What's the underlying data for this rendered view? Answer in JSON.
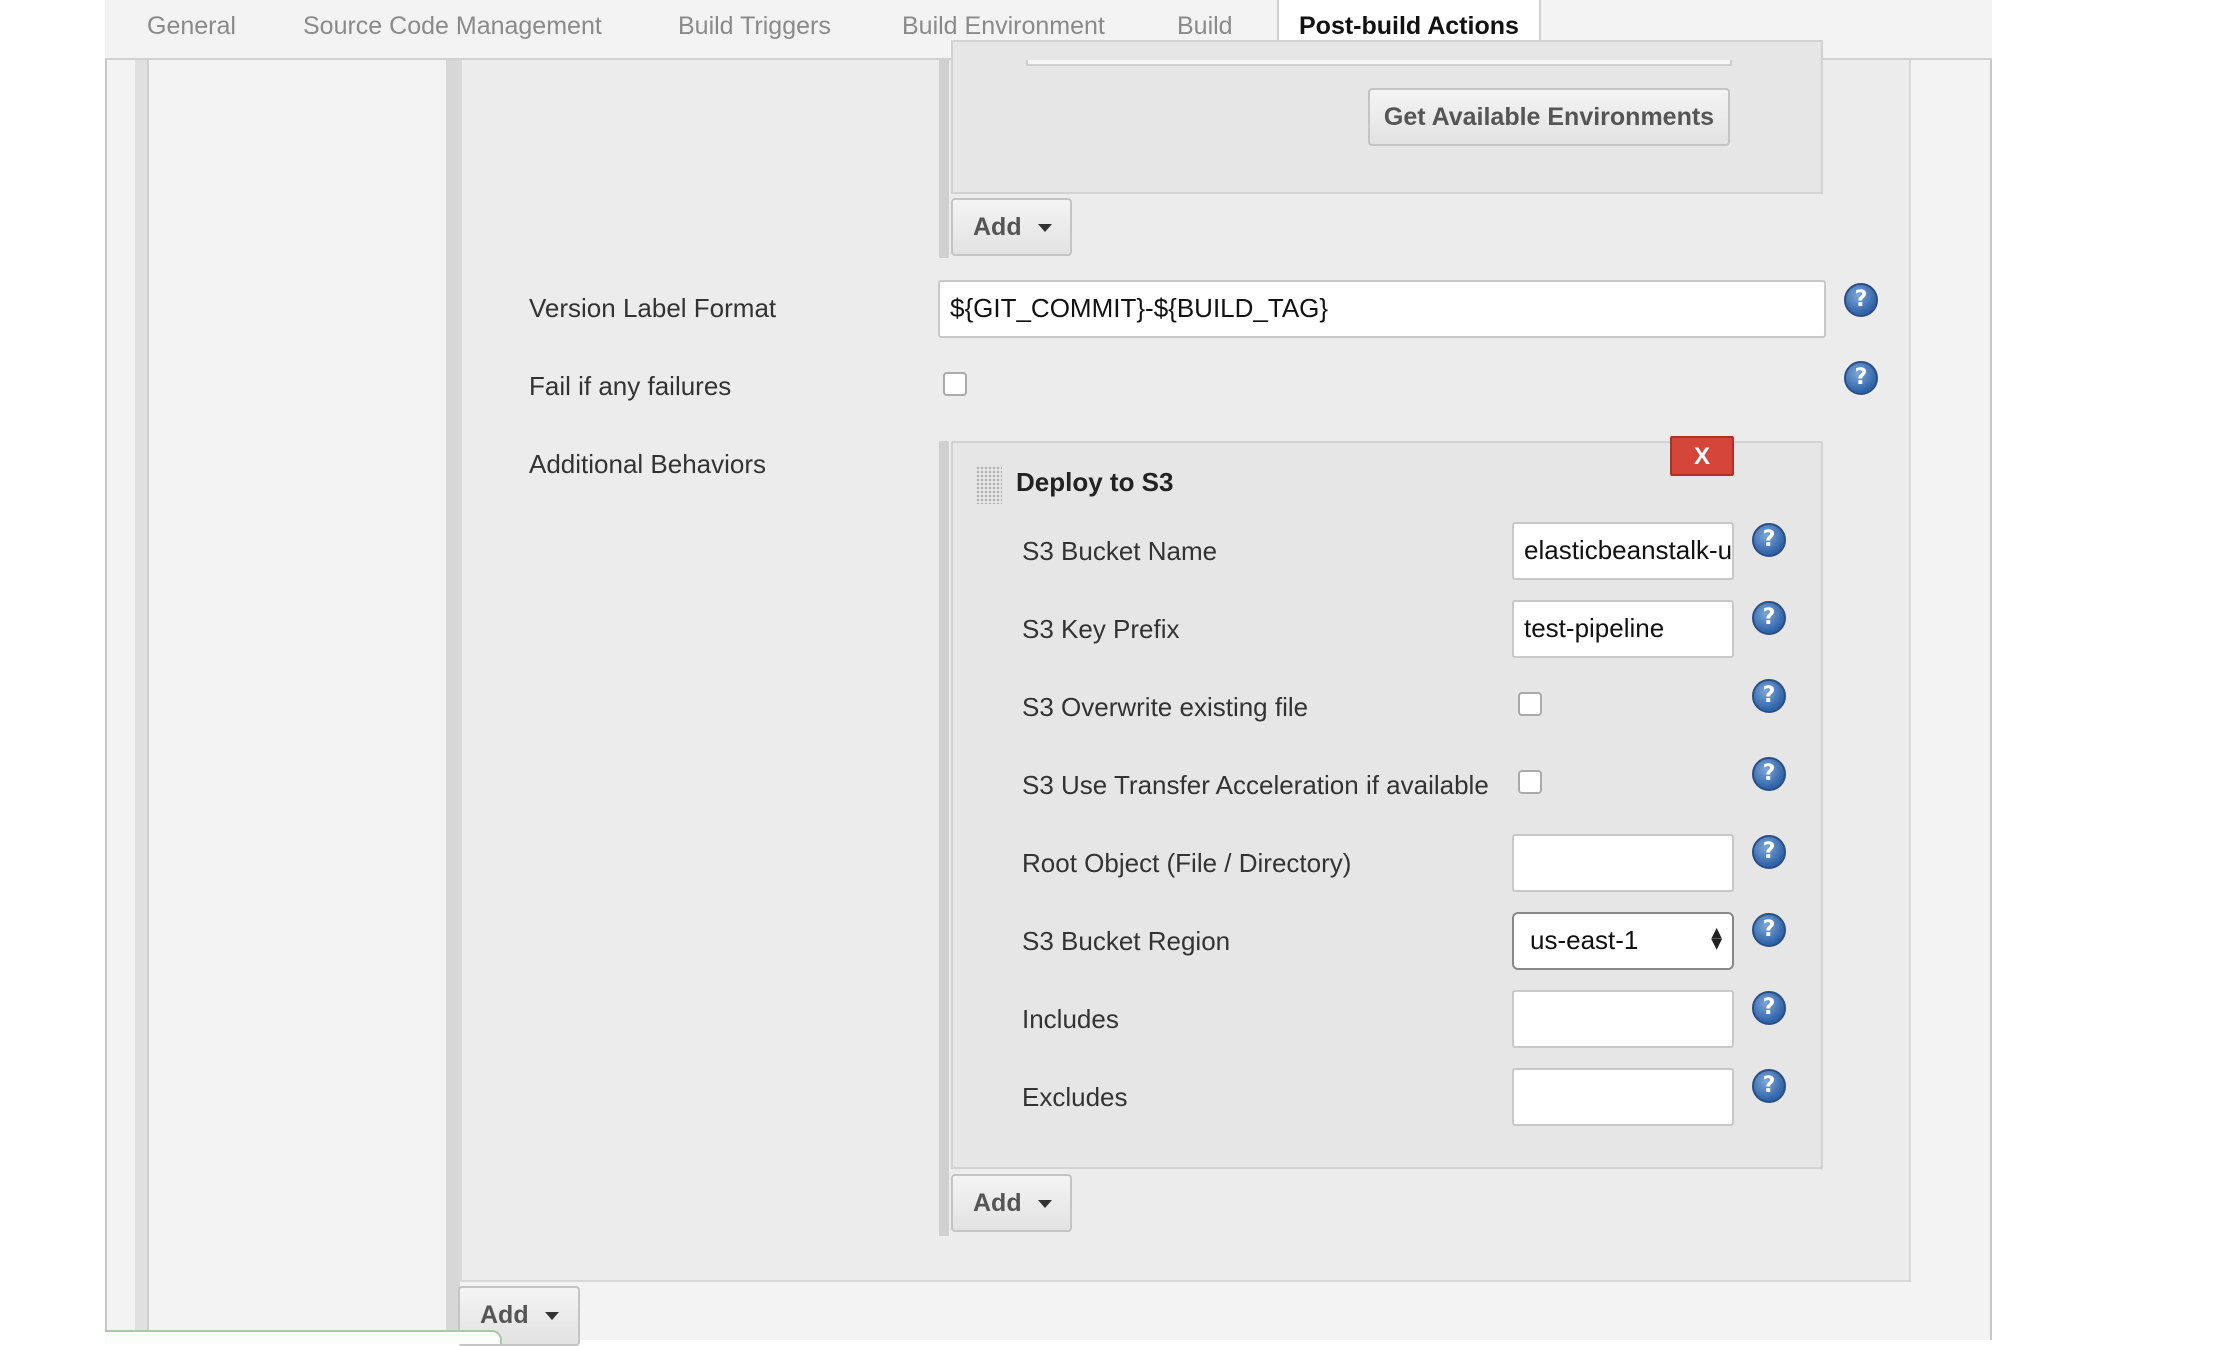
{
  "tabs": [
    {
      "label": "General"
    },
    {
      "label": "Source Code Management"
    },
    {
      "label": "Build Triggers"
    },
    {
      "label": "Build Environment"
    },
    {
      "label": "Build"
    },
    {
      "label": "Post-build Actions",
      "active": true
    }
  ],
  "environments": {
    "get_button_label": "Get Available Environments",
    "add_button_label": "Add"
  },
  "version_label": {
    "label": "Version Label Format",
    "value": "${GIT_COMMIT}-${BUILD_TAG}",
    "help_icon": "?"
  },
  "fail_on_failures": {
    "label": "Fail if any failures",
    "checked": false,
    "help_icon": "?"
  },
  "additional_behaviors": {
    "label": "Additional Behaviors",
    "add_button_label": "Add",
    "deploy_to_s3": {
      "title": "Deploy to S3",
      "delete_label": "X",
      "fields": {
        "bucket_name": {
          "label": "S3 Bucket Name",
          "value": "elasticbeanstalk-u"
        },
        "key_prefix": {
          "label": "S3 Key Prefix",
          "value": "test-pipeline"
        },
        "overwrite": {
          "label": "S3 Overwrite existing file",
          "checked": false
        },
        "transfer_accel": {
          "label": "S3 Use Transfer Acceleration if available",
          "checked": false
        },
        "root_object": {
          "label": "Root Object (File / Directory)",
          "value": ""
        },
        "bucket_region": {
          "label": "S3 Bucket Region",
          "value": "us-east-1"
        },
        "includes": {
          "label": "Includes",
          "value": ""
        },
        "excludes": {
          "label": "Excludes",
          "value": ""
        }
      }
    }
  },
  "post_build_add_label": "Add",
  "help_icon_glyph": "?",
  "colors": {
    "delete_button": "#d4453a",
    "help_icon": "#2f63a8",
    "panel_bg": "#e6e6e6"
  }
}
